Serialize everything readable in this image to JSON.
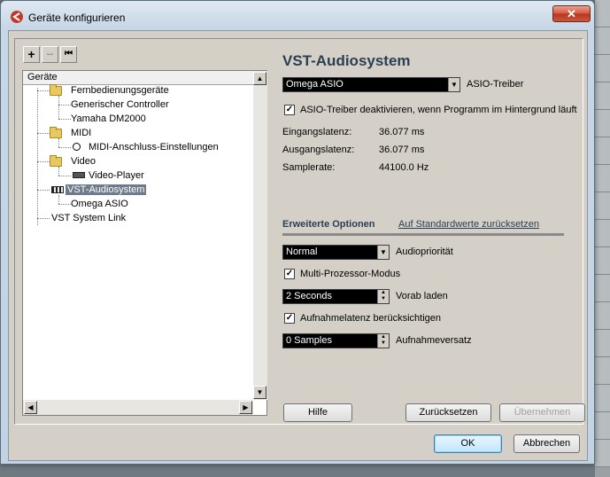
{
  "window": {
    "title": "Geräte konfigurieren",
    "close_glyph": "✕"
  },
  "toolbar": {
    "add_label": "+",
    "remove_label": "−",
    "reset_label": "⏮"
  },
  "tree": {
    "header": "Geräte",
    "items": [
      {
        "label": "Fernbedienungsgeräte",
        "icon": "folder-icon"
      },
      {
        "label": "Generischer Controller"
      },
      {
        "label": "Yamaha DM2000"
      },
      {
        "label": "MIDI",
        "icon": "folder-icon"
      },
      {
        "label": "MIDI-Anschluss-Einstellungen",
        "icon": "midi-port-icon"
      },
      {
        "label": "Video",
        "icon": "folder-icon"
      },
      {
        "label": "Video-Player",
        "icon": "video-player-icon"
      },
      {
        "label": "VST-Audiosystem",
        "icon": "audio-system-icon"
      },
      {
        "label": "Omega ASIO"
      },
      {
        "label": "VST System Link"
      }
    ]
  },
  "main": {
    "title": "VST-Audiosystem",
    "driver": {
      "value": "Omega ASIO",
      "label": "ASIO-Treiber"
    },
    "deactivate_checkbox": {
      "checked": true,
      "label": "ASIO-Treiber deaktivieren, wenn Programm im Hintergrund läuft"
    },
    "info": [
      {
        "label": "Eingangslatenz:",
        "value": "36.077 ms"
      },
      {
        "label": "Ausgangslatenz:",
        "value": "36.077 ms"
      },
      {
        "label": "Samplerate:",
        "value": "44100.0 Hz"
      }
    ],
    "tabs": {
      "active": "Erweiterte Optionen",
      "link": "Auf Standardwerte zurücksetzen"
    },
    "priority": {
      "value": "Normal",
      "label": "Audiopriorität"
    },
    "multiprocessor": {
      "checked": true,
      "label": "Multi-Prozessor-Modus"
    },
    "preload": {
      "value": "2 Seconds",
      "label": "Vorab laden"
    },
    "latency_checkbox": {
      "checked": true,
      "label": "Aufnahmelatenz berücksichtigen"
    },
    "offset": {
      "value": "0 Samples",
      "label": "Aufnahmeversatz"
    }
  },
  "buttons": {
    "help": "Hilfe",
    "reset": "Zurücksetzen",
    "apply": "Übernehmen",
    "ok": "OK",
    "cancel": "Abbrechen"
  },
  "colors": {
    "accent": "#2c3e52",
    "selection": "#6d7b8c",
    "combo_bg": "#000000"
  }
}
